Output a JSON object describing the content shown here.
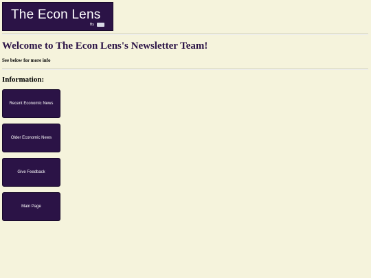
{
  "header": {
    "logo_title": "The Econ Lens",
    "logo_byline": "By"
  },
  "welcome": {
    "title": "Welcome to The Econ Lens's Newsletter Team!",
    "subtitle": "See below for more info"
  },
  "information": {
    "heading": "Information:",
    "buttons": [
      {
        "label": "Recent Economic News"
      },
      {
        "label": "Older Economic News"
      },
      {
        "label": "Give Feedback"
      },
      {
        "label": "Main Page"
      }
    ]
  },
  "colors": {
    "page_background": "#f5f3dc",
    "brand_purple": "#2b1346",
    "button_text": "#ffffff"
  }
}
